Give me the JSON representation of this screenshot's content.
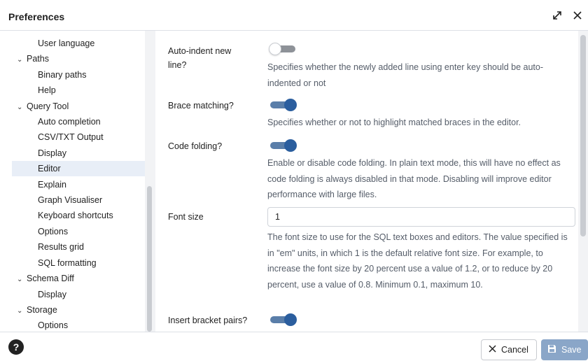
{
  "dialog": {
    "title": "Preferences"
  },
  "sidebar": {
    "items": [
      {
        "label": "User language",
        "level": 2
      },
      {
        "label": "Paths",
        "level": 1,
        "expanded": true
      },
      {
        "label": "Binary paths",
        "level": 2
      },
      {
        "label": "Help",
        "level": 2
      },
      {
        "label": "Query Tool",
        "level": 1,
        "expanded": true
      },
      {
        "label": "Auto completion",
        "level": 2
      },
      {
        "label": "CSV/TXT Output",
        "level": 2
      },
      {
        "label": "Display",
        "level": 2
      },
      {
        "label": "Editor",
        "level": 2,
        "selected": true
      },
      {
        "label": "Explain",
        "level": 2
      },
      {
        "label": "Graph Visualiser",
        "level": 2
      },
      {
        "label": "Keyboard shortcuts",
        "level": 2
      },
      {
        "label": "Options",
        "level": 2
      },
      {
        "label": "Results grid",
        "level": 2
      },
      {
        "label": "SQL formatting",
        "level": 2
      },
      {
        "label": "Schema Diff",
        "level": 1,
        "expanded": true
      },
      {
        "label": "Display",
        "level": 2
      },
      {
        "label": "Storage",
        "level": 1,
        "expanded": true
      },
      {
        "label": "Options",
        "level": 2
      }
    ]
  },
  "settings": {
    "auto_indent": {
      "label": "Auto-indent new line?",
      "value": false,
      "description": "Specifies whether the newly added line using enter key should be auto-indented or not"
    },
    "brace_matching": {
      "label": "Brace matching?",
      "value": true,
      "description": "Specifies whether or not to highlight matched braces in the editor."
    },
    "code_folding": {
      "label": "Code folding?",
      "value": true,
      "description": "Enable or disable code folding. In plain text mode, this will have no effect as code folding is always disabled in that mode. Disabling will improve editor performance with large files."
    },
    "font_size": {
      "label": "Font size",
      "value": "1",
      "description": "The font size to use for the SQL text boxes and editors. The value specified is in \"em\" units, in which 1 is the default relative font size. For example, to increase the font size by 20 percent use a value of 1.2, or to reduce by 20 percent, use a value of 0.8. Minimum 0.1, maximum 10."
    },
    "insert_bracket": {
      "label": "Insert bracket pairs?",
      "value": true
    }
  },
  "footer": {
    "help_label": "?",
    "cancel_label": "Cancel",
    "save_label": "Save"
  },
  "colors": {
    "accent": "#2b5e9e",
    "selected_bg": "#e8eef7",
    "save_disabled": "#8aa6c8"
  }
}
